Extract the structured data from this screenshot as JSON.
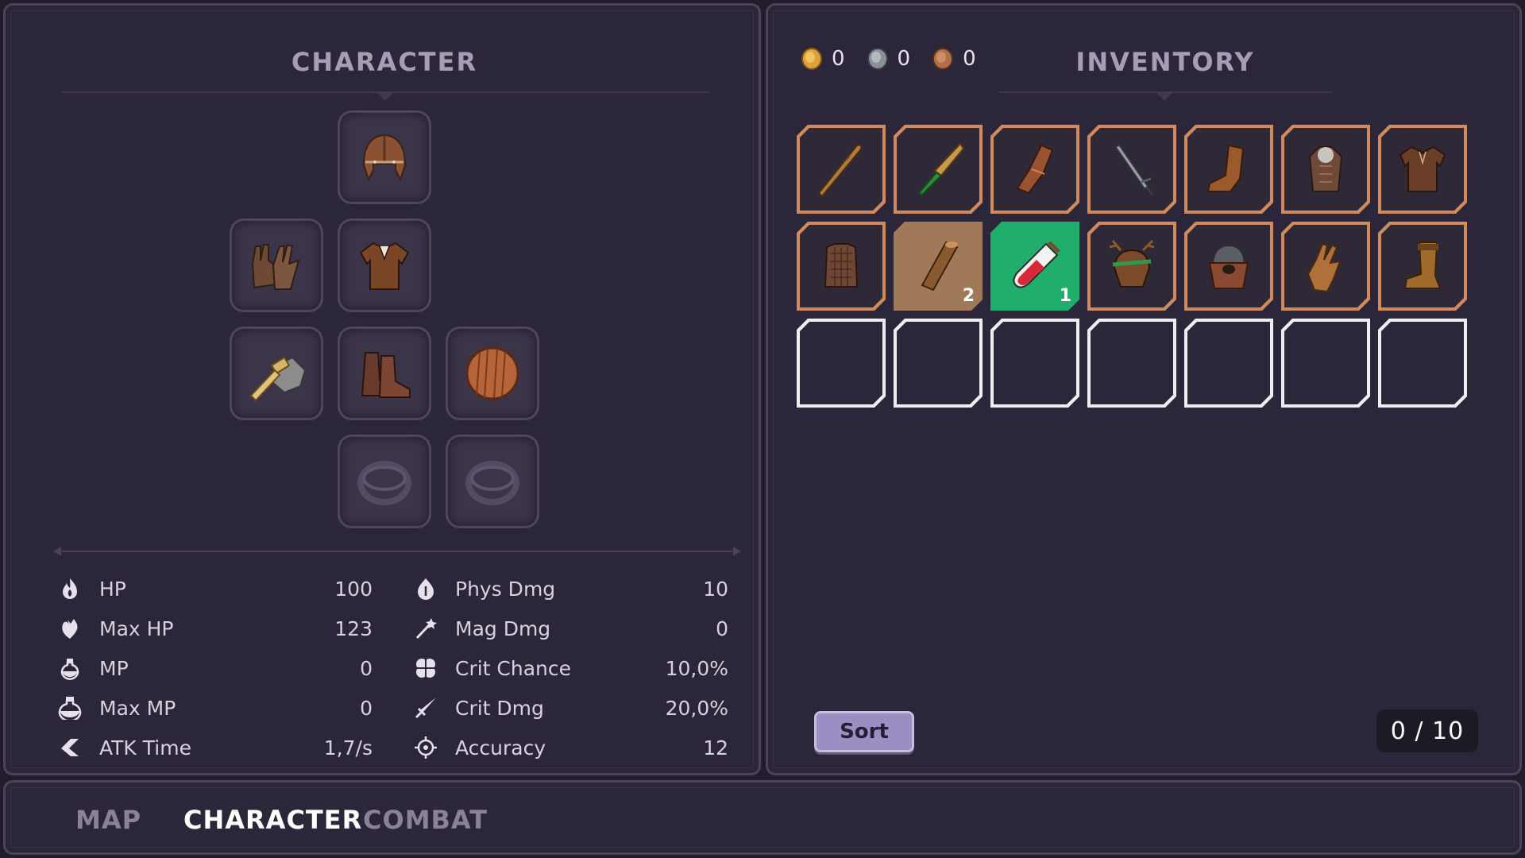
{
  "character_panel": {
    "title": "CHARACTER",
    "equipment": [
      {
        "slot": "head",
        "icon": "leather-helmet-icon"
      },
      {
        "slot": "hands",
        "icon": "leather-gloves-icon"
      },
      {
        "slot": "chest",
        "icon": "leather-tunic-icon"
      },
      {
        "slot": "weapon",
        "icon": "stone-hammer-icon"
      },
      {
        "slot": "feet",
        "icon": "leather-boots-icon"
      },
      {
        "slot": "offhand",
        "icon": "wooden-shield-icon"
      },
      {
        "slot": "ring1",
        "icon": "ring-placeholder-icon"
      },
      {
        "slot": "ring2",
        "icon": "ring-placeholder-icon"
      }
    ],
    "stats_left": [
      {
        "icon": "flame-icon",
        "label": "HP",
        "value": "100"
      },
      {
        "icon": "heart-leaf-icon",
        "label": "Max HP",
        "value": "123"
      },
      {
        "icon": "potion-icon",
        "label": "MP",
        "value": "0"
      },
      {
        "icon": "potion-large-icon",
        "label": "Max MP",
        "value": "0"
      },
      {
        "icon": "arrow-speed-icon",
        "label": "ATK Time",
        "value": "1,7/s"
      }
    ],
    "stats_right": [
      {
        "icon": "fire-drop-icon",
        "label": "Phys Dmg",
        "value": "10"
      },
      {
        "icon": "wand-icon",
        "label": "Mag Dmg",
        "value": "0"
      },
      {
        "icon": "clover-icon",
        "label": "Crit Chance",
        "value": "10,0%"
      },
      {
        "icon": "sword-slash-icon",
        "label": "Crit Dmg",
        "value": "20,0%"
      },
      {
        "icon": "crosshair-icon",
        "label": "Accuracy",
        "value": "12"
      }
    ]
  },
  "inventory_panel": {
    "title": "INVENTORY",
    "coins": [
      {
        "icon": "gold-coin-icon",
        "amount": "0",
        "color": "#d9a23a"
      },
      {
        "icon": "silver-coin-icon",
        "amount": "0",
        "color": "#8a8f98"
      },
      {
        "icon": "copper-coin-icon",
        "amount": "0",
        "color": "#b0704a"
      }
    ],
    "items": [
      {
        "icon": "wooden-club-icon",
        "count": "",
        "state": "normal"
      },
      {
        "icon": "horn-dagger-icon",
        "count": "",
        "state": "normal"
      },
      {
        "icon": "leather-bracer-icon",
        "count": "",
        "state": "normal"
      },
      {
        "icon": "iron-sword-icon",
        "count": "",
        "state": "normal"
      },
      {
        "icon": "leather-boot-icon",
        "count": "",
        "state": "normal"
      },
      {
        "icon": "fur-armor-icon",
        "count": "",
        "state": "normal"
      },
      {
        "icon": "brown-shirt-icon",
        "count": "",
        "state": "normal"
      },
      {
        "icon": "chainmail-vest-icon",
        "count": "",
        "state": "normal"
      },
      {
        "icon": "wood-log-icon",
        "count": "2",
        "state": "dim"
      },
      {
        "icon": "health-potion-icon",
        "count": "1",
        "state": "selected"
      },
      {
        "icon": "antler-helmet-icon",
        "count": "",
        "state": "normal"
      },
      {
        "icon": "iron-coif-icon",
        "count": "",
        "state": "normal"
      },
      {
        "icon": "leather-glove-icon",
        "count": "",
        "state": "normal"
      },
      {
        "icon": "tall-boot-icon",
        "count": "",
        "state": "normal"
      }
    ],
    "empty_slots": 7,
    "sort_label": "Sort",
    "capacity": "0 / 10"
  },
  "nav": {
    "tabs": [
      {
        "label": "MAP",
        "active": false
      },
      {
        "label": "CHARACTER",
        "active": true
      },
      {
        "label": "COMBAT",
        "active": false
      }
    ],
    "active_color": "#ffffff",
    "inactive_color": "#8a8296"
  }
}
